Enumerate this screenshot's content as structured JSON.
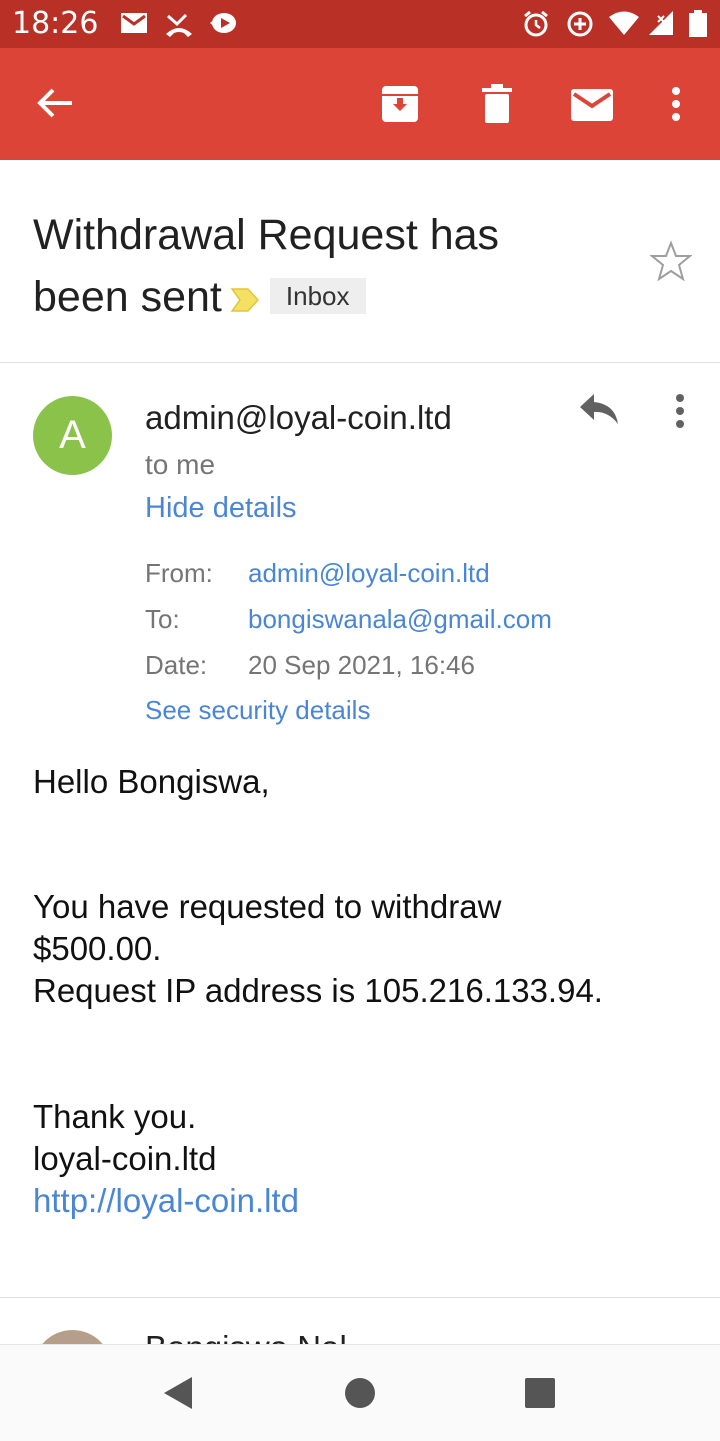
{
  "status_bar": {
    "time": "18:26",
    "left_icons": [
      "gmail-icon",
      "missed-call-icon",
      "location-icon"
    ],
    "right_icons": [
      "alarm-icon",
      "data-saver-icon",
      "wifi-icon",
      "signal-icon",
      "battery-icon"
    ]
  },
  "toolbar": {
    "color": "#db4437",
    "icons": [
      "back-arrow-icon",
      "archive-icon",
      "delete-icon",
      "mark-unread-icon",
      "more-vert-icon"
    ]
  },
  "email": {
    "subject": "Withdrawal Request has been sent",
    "label": "Inbox",
    "sender_initial": "A",
    "sender": "admin@loyal-coin.ltd",
    "recipient_summary": "to me",
    "hide_details": "Hide details",
    "details": {
      "from_label": "From:",
      "from_value": "admin@loyal-coin.ltd",
      "to_label": "To:",
      "to_value": "bongiswanala@gmail.com",
      "date_label": "Date:",
      "date_value": "20 Sep 2021, 16:46"
    },
    "security_link": "See security details",
    "body": {
      "greeting": "Hello Bongiswa,",
      "line1": "You have requested to withdraw",
      "line2": "$500.00.",
      "line3": "Request IP address is 105.216.133.94.",
      "thanks": "Thank you.",
      "signature": "loyal-coin.ltd",
      "link": "http://loyal-coin.ltd"
    }
  },
  "next_message": {
    "sender_partial": "Bongiswa Nal"
  },
  "nav_bar": {
    "icons": [
      "back-triangle-icon",
      "home-circle-icon",
      "recents-square-icon"
    ]
  }
}
